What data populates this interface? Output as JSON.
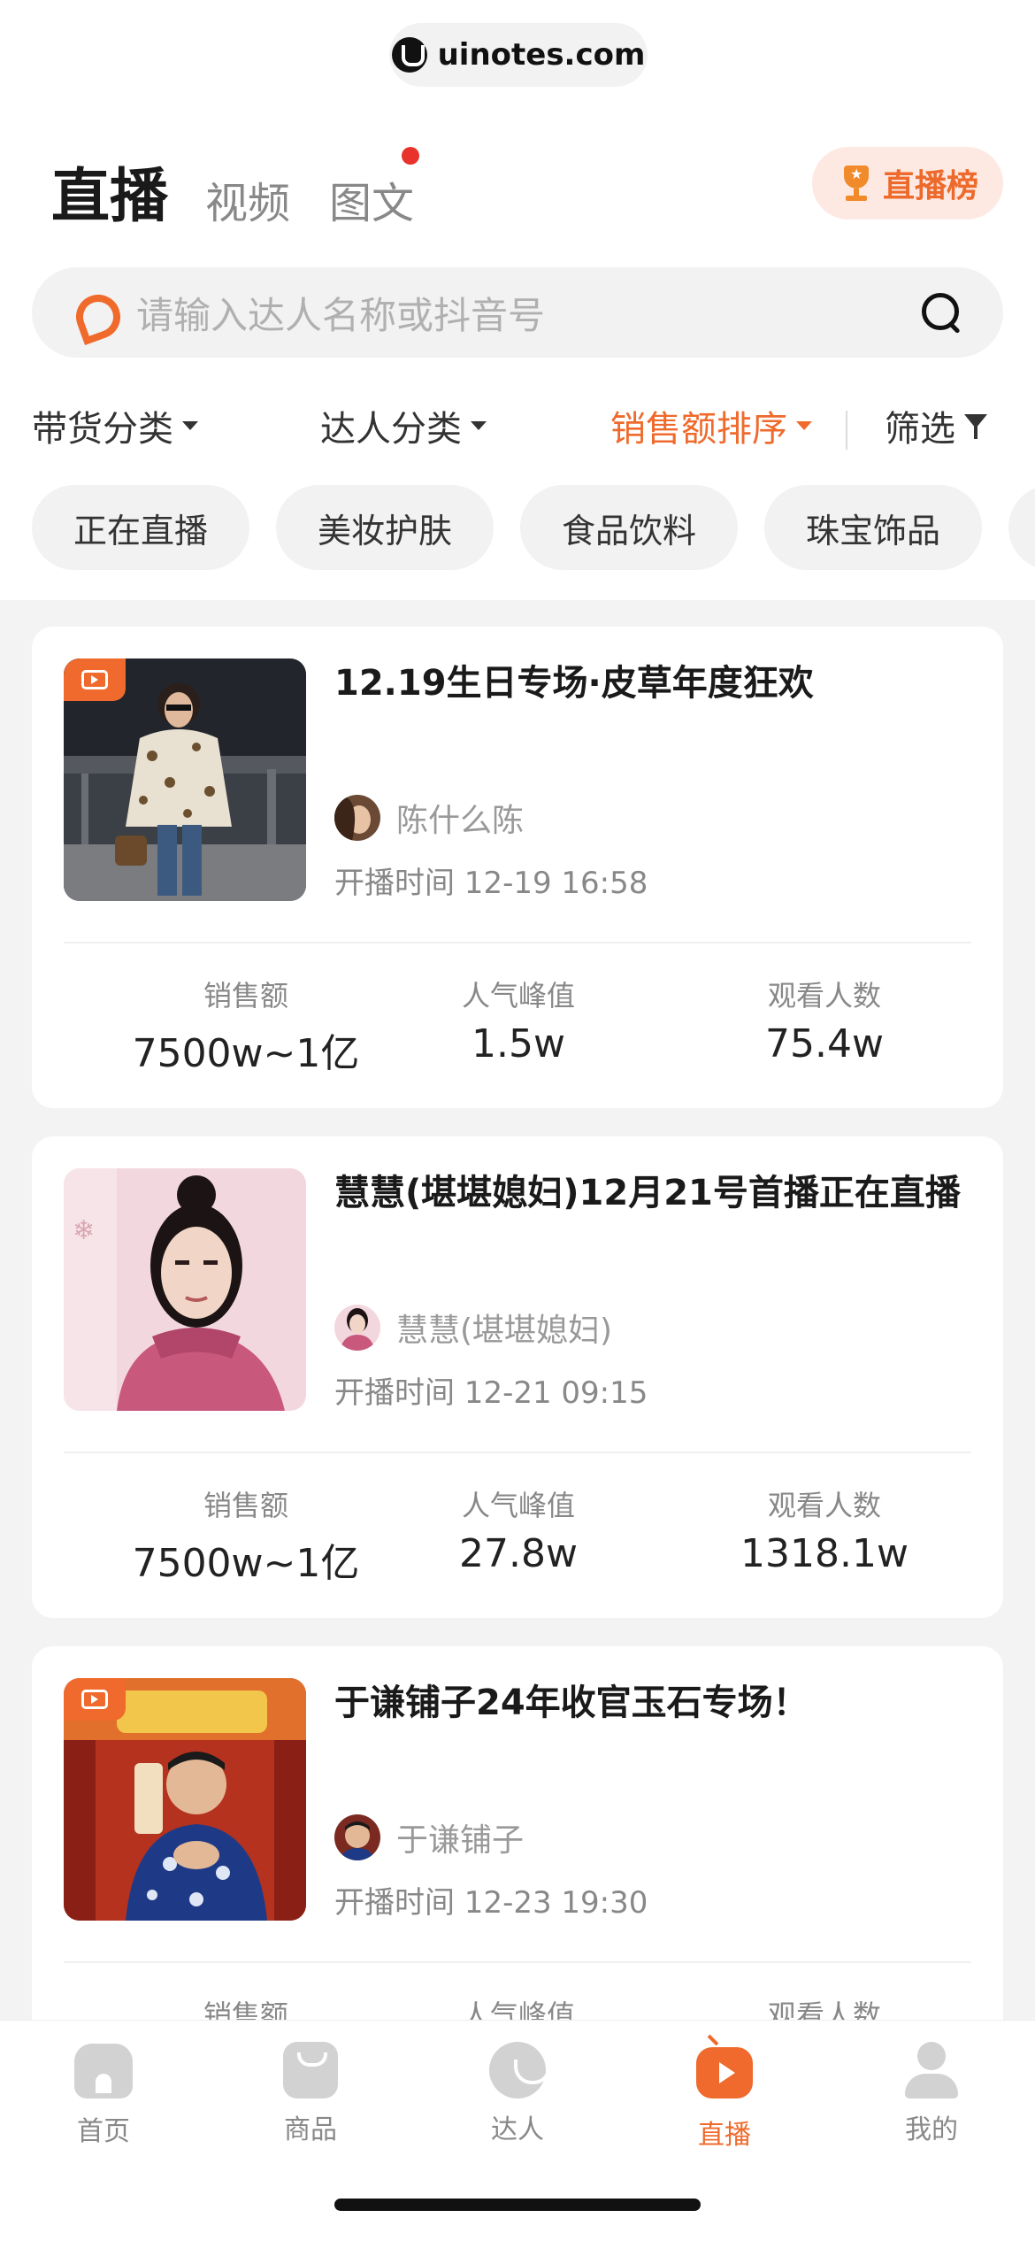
{
  "browser": {
    "url": "uinotes.com"
  },
  "header": {
    "tabs": [
      {
        "label": "直播",
        "active": true
      },
      {
        "label": "视频",
        "active": false
      },
      {
        "label": "图文",
        "active": false,
        "has_dot": true
      }
    ],
    "rank_button": "直播榜"
  },
  "search": {
    "placeholder": "请输入达人名称或抖音号"
  },
  "filters": {
    "goods_category": "带货分类",
    "talent_category": "达人分类",
    "sort": "销售额排序",
    "screen": "筛选"
  },
  "chips": [
    "正在直播",
    "美妆护肤",
    "食品饮料",
    "珠宝饰品"
  ],
  "stat_labels": {
    "sales": "销售额",
    "peak": "人气峰值",
    "viewers": "观看人数"
  },
  "cards": [
    {
      "title": "12.19生日专场·皮草年度狂欢",
      "host": "陈什么陈",
      "start_time": "开播时间 12-19 16:58",
      "is_live": true,
      "sales": "7500w~1亿",
      "peak": "1.5w",
      "viewers": "75.4w"
    },
    {
      "title": "慧慧(堪堪媳妇)12月21号首播正在直播",
      "host": "慧慧(堪堪媳妇)",
      "start_time": "开播时间 12-21 09:15",
      "is_live": false,
      "sales": "7500w~1亿",
      "peak": "27.8w",
      "viewers": "1318.1w"
    },
    {
      "title": "于谦铺子24年收官玉石专场！",
      "host": "于谦铺子",
      "start_time": "开播时间 12-23 19:30",
      "is_live": true,
      "sales": "",
      "peak": "",
      "viewers": ""
    }
  ],
  "tabbar": [
    {
      "label": "首页",
      "icon": "home-icon",
      "active": false
    },
    {
      "label": "商品",
      "icon": "bag-icon",
      "active": false
    },
    {
      "label": "达人",
      "icon": "talent-icon",
      "active": false
    },
    {
      "label": "直播",
      "icon": "live-tv-icon",
      "active": true
    },
    {
      "label": "我的",
      "icon": "profile-icon",
      "active": false
    }
  ],
  "colors": {
    "accent": "#ef6a2c",
    "badge_bg": "#fde9e2",
    "dot": "#e8322b"
  }
}
